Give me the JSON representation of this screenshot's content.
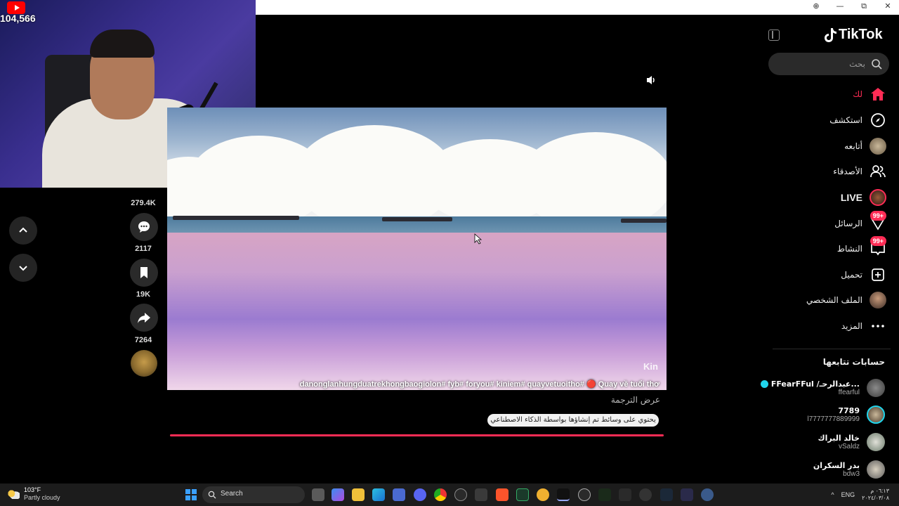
{
  "webcam": {
    "view_count": "104,566"
  },
  "browser": {
    "controls": [
      "⊕",
      "—",
      "⧉",
      "✕"
    ]
  },
  "actions": {
    "likes": "279.4K",
    "comments": "2117",
    "saves": "19K",
    "shares": "7264"
  },
  "video": {
    "caption": "danonglanhungduatrekhongbaogiolon# fyb# foryou# kiniem# quayvetuoitho# 🔴 Quay về tuổi thơ",
    "watermark": "Kin",
    "translate_label": "عرض الترجمة",
    "ai_label": "يحتوي على وسائط تم إنشاؤها بواسطة الذكاء الاصطناعي"
  },
  "sidebar": {
    "logo": "TikTok",
    "search_placeholder": "بحث",
    "menu": [
      {
        "label": "لك",
        "icon": "home-icon",
        "active": true
      },
      {
        "label": "استكشف",
        "icon": "compass-icon"
      },
      {
        "label": "أتابعه",
        "icon": "following-avatar"
      },
      {
        "label": "الأصدقاء",
        "icon": "friends-icon"
      },
      {
        "label": "LIVE",
        "icon": "live-avatar"
      },
      {
        "label": "الرسائل",
        "icon": "messages-icon",
        "badge": "99+"
      },
      {
        "label": "النشاط",
        "icon": "activity-icon",
        "badge": "99+"
      },
      {
        "label": "تحميل",
        "icon": "upload-icon"
      },
      {
        "label": "الملف الشخصي",
        "icon": "profile-avatar"
      },
      {
        "label": "المزيد",
        "icon": "more-icon"
      }
    ],
    "following_title": "حسابات تتابعها",
    "following": [
      {
        "name": "FFearFFul /عبدالرحـ...",
        "user": "ffearful",
        "verified": true
      },
      {
        "name": "7789",
        "user": "l7777777889999"
      },
      {
        "name": "خالد البراك",
        "user": "vSaldz"
      },
      {
        "name": "بدر السكران",
        "user": "bdw3"
      }
    ]
  },
  "taskbar": {
    "weather_temp": "103°F",
    "weather_cond": "Partly cloudy",
    "search_label": "Search",
    "lang": "ENG",
    "time": "٠٦:١٣ م",
    "date": "٢٠٢٤/٠٣/٠٨"
  },
  "colors": {
    "accent": "#fe2c55",
    "verified": "#20d5ec"
  }
}
